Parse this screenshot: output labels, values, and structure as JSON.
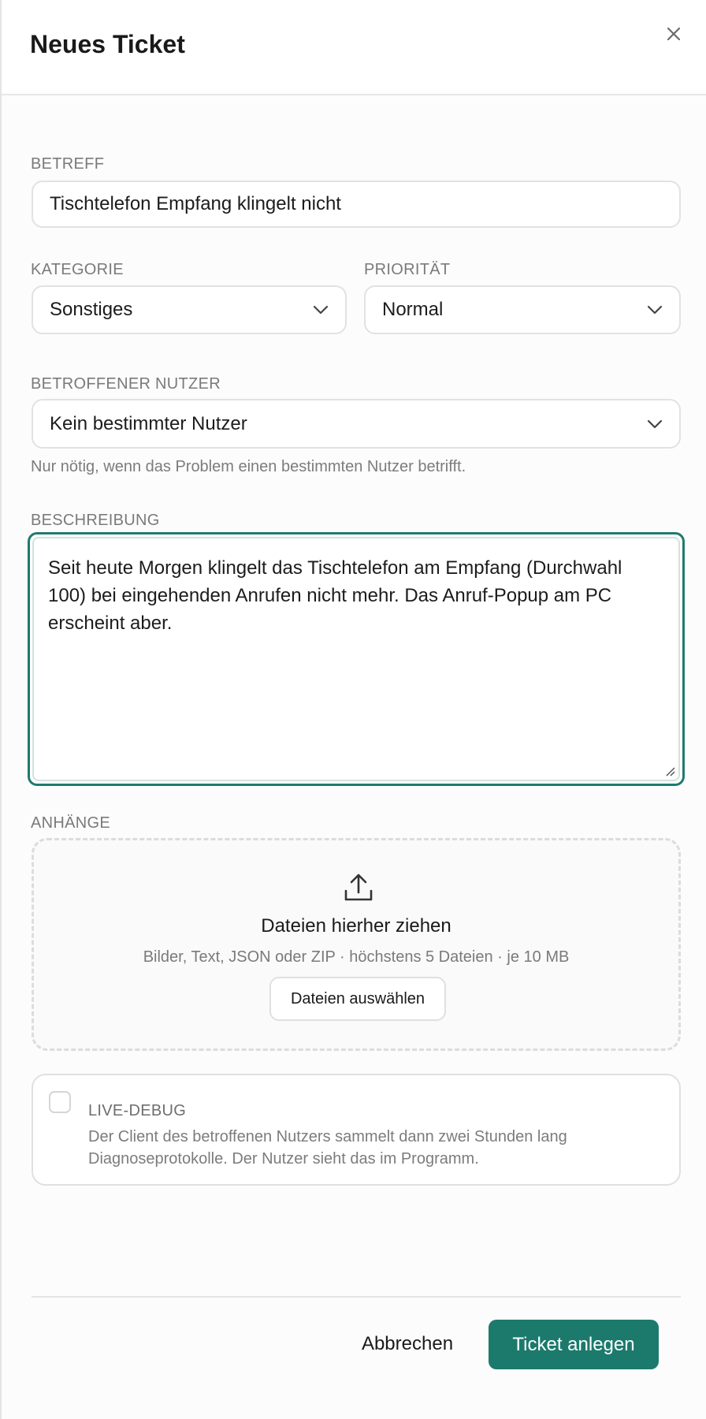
{
  "header": {
    "title": "Neues Ticket",
    "close_icon": "close-icon"
  },
  "form": {
    "subject": {
      "label": "BETREFF",
      "value": "Tischtelefon Empfang klingelt nicht"
    },
    "category": {
      "label": "KATEGORIE",
      "value": "Sonstiges"
    },
    "priority": {
      "label": "PRIORITÄT",
      "value": "Normal"
    },
    "affected_user": {
      "label": "BETROFFENER NUTZER",
      "value": "Kein bestimmter Nutzer",
      "hint": "Nur nötig, wenn das Problem einen bestimmten Nutzer betrifft."
    },
    "description": {
      "label": "BESCHREIBUNG",
      "value": "Seit heute Morgen klingelt das Tischtelefon am Empfang (Durchwahl 100) bei eingehenden Anrufen nicht mehr. Das Anruf-Popup am PC erscheint aber."
    },
    "attachments": {
      "label": "ANHÄNGE",
      "drop_title": "Dateien hierher ziehen",
      "drop_subtitle": "Bilder, Text, JSON oder ZIP · höchstens 5 Dateien · je 10 MB",
      "select_button": "Dateien auswählen",
      "icon": "upload-icon"
    },
    "live_debug": {
      "title": "LIVE-DEBUG",
      "description": "Der Client des betroffenen Nutzers sammelt dann zwei Stunden lang Diagnoseprotokolle. Der Nutzer sieht das im Programm.",
      "checked": false
    }
  },
  "footer": {
    "cancel_label": "Abbrechen",
    "submit_label": "Ticket anlegen"
  },
  "colors": {
    "accent": "#1c7a6d",
    "focus_border": "#1f7a6e",
    "muted_text": "#7a7a7a"
  }
}
